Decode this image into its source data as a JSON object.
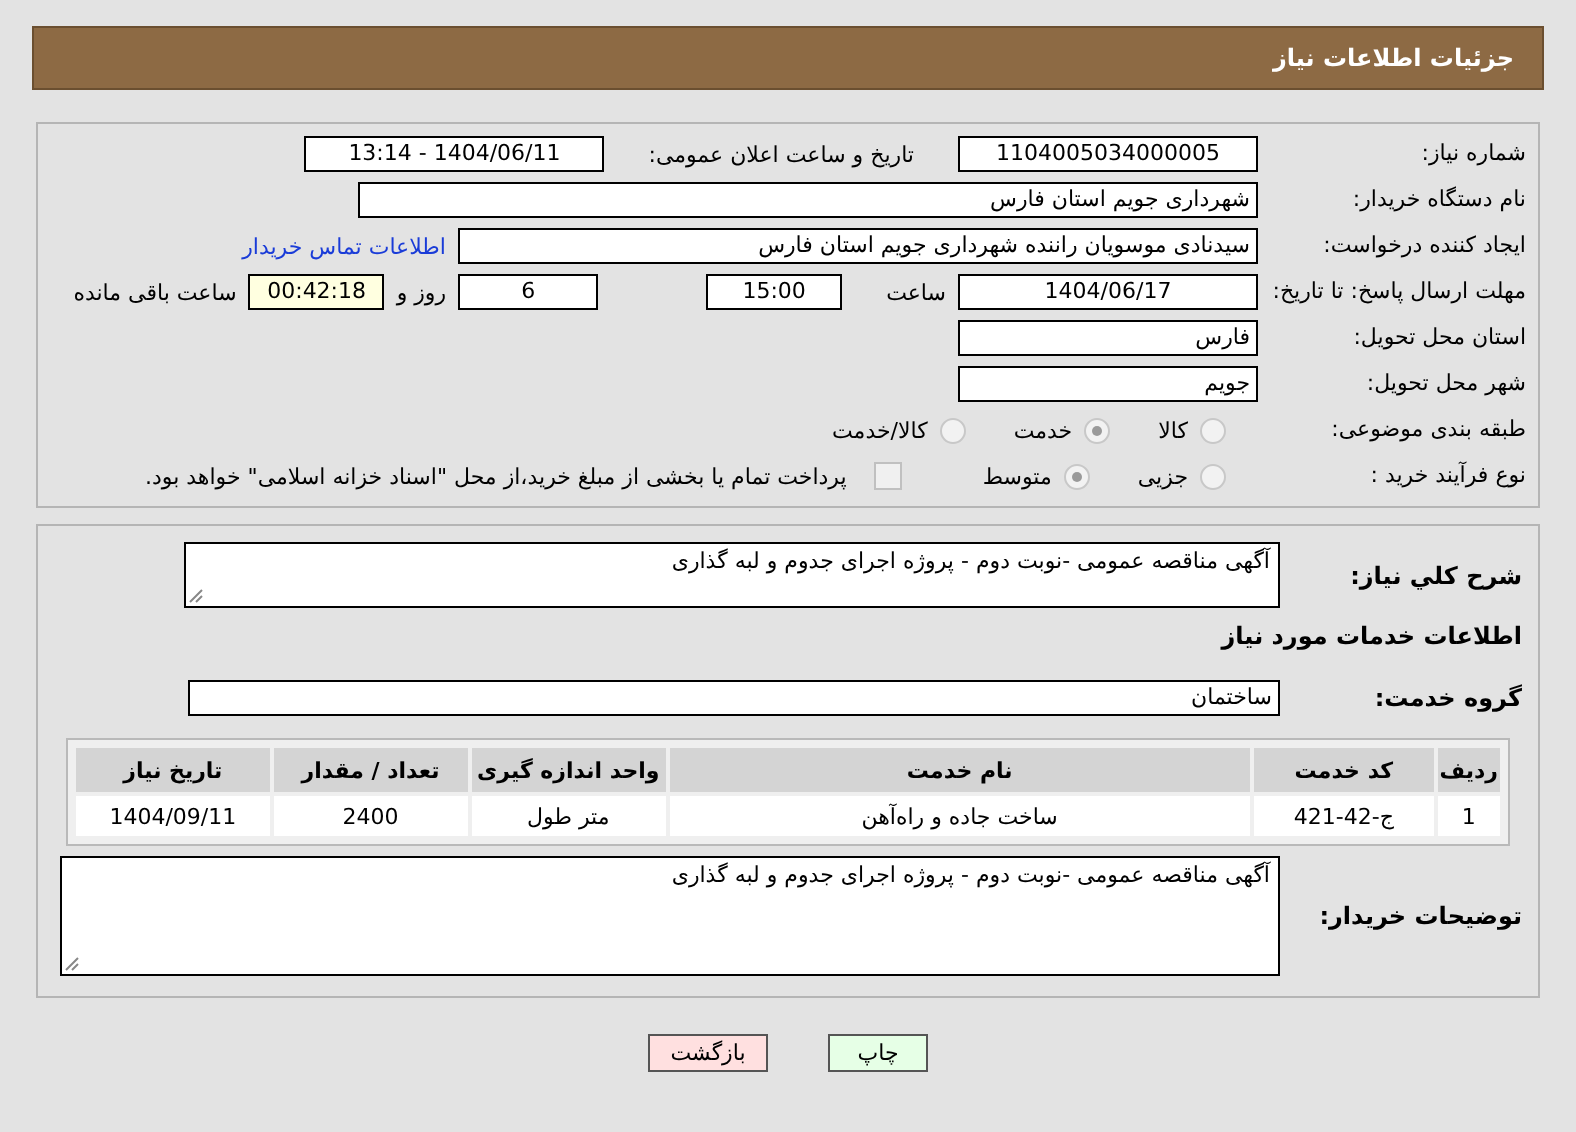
{
  "header": {
    "title": "جزئیات اطلاعات نیاز"
  },
  "details": {
    "need_number": {
      "label": "شماره نیاز:",
      "value": "1104005034000005"
    },
    "announce": {
      "label": "تاریخ و ساعت اعلان عمومی:",
      "value": "1404/06/11 - 13:14"
    },
    "buyer": {
      "label": "نام دستگاه خریدار:",
      "value": "شهرداری جویم استان فارس"
    },
    "creator": {
      "label": "ایجاد کننده درخواست:",
      "value": "سیدنادی موسویان راننده شهرداری جویم استان فارس",
      "link": "اطلاعات تماس خریدار"
    },
    "deadline": {
      "label": "مهلت ارسال پاسخ: تا تاریخ:",
      "date": "1404/06/17",
      "time_label": "ساعت",
      "time": "15:00",
      "days": "6",
      "days_label": "روز و",
      "remaining": "00:42:18",
      "remaining_label": "ساعت باقی مانده"
    },
    "province": {
      "label": "استان محل تحویل:",
      "value": "فارس"
    },
    "city": {
      "label": "شهر محل تحویل:",
      "value": "جویم"
    },
    "category": {
      "label": "طبقه بندی موضوعی:",
      "options": [
        {
          "label": "کالا",
          "selected": false
        },
        {
          "label": "خدمت",
          "selected": true
        },
        {
          "label": "کالا/خدمت",
          "selected": false
        }
      ]
    },
    "process": {
      "label": "نوع فرآیند خرید :",
      "options": [
        {
          "label": "جزیی",
          "selected": false
        },
        {
          "label": "متوسط",
          "selected": true
        }
      ],
      "payment": {
        "label": "پرداخت تمام یا بخشی از مبلغ خرید،از محل \"اسناد خزانه اسلامی\" خواهد بود.",
        "checked": false
      }
    }
  },
  "services": {
    "description": {
      "label": "شرح کلي نياز:",
      "value": "آگهی مناقصه عمومی -نوبت دوم - پروژه اجرای جدوم و لبه گذاری"
    },
    "heading": "اطلاعات خدمات مورد نیاز",
    "group": {
      "label": "گروه خدمت:",
      "value": "ساختمان"
    },
    "table": {
      "columns": [
        "ردیف",
        "کد خدمت",
        "نام خدمت",
        "واحد اندازه گیری",
        "تعداد / مقدار",
        "تاریخ نیاز"
      ],
      "rows": [
        [
          "1",
          "ج-42-421",
          "ساخت جاده و راه‌آهن",
          "متر طول",
          "2400",
          "1404/09/11"
        ]
      ]
    },
    "buyer_notes": {
      "label": "توضیحات خریدار:",
      "value": "آگهی مناقصه عمومی -نوبت دوم - پروژه اجرای جدوم و لبه گذاری"
    }
  },
  "buttons": [
    {
      "label": "چاپ",
      "kind": "print"
    },
    {
      "label": "بازگشت",
      "kind": "back"
    }
  ]
}
